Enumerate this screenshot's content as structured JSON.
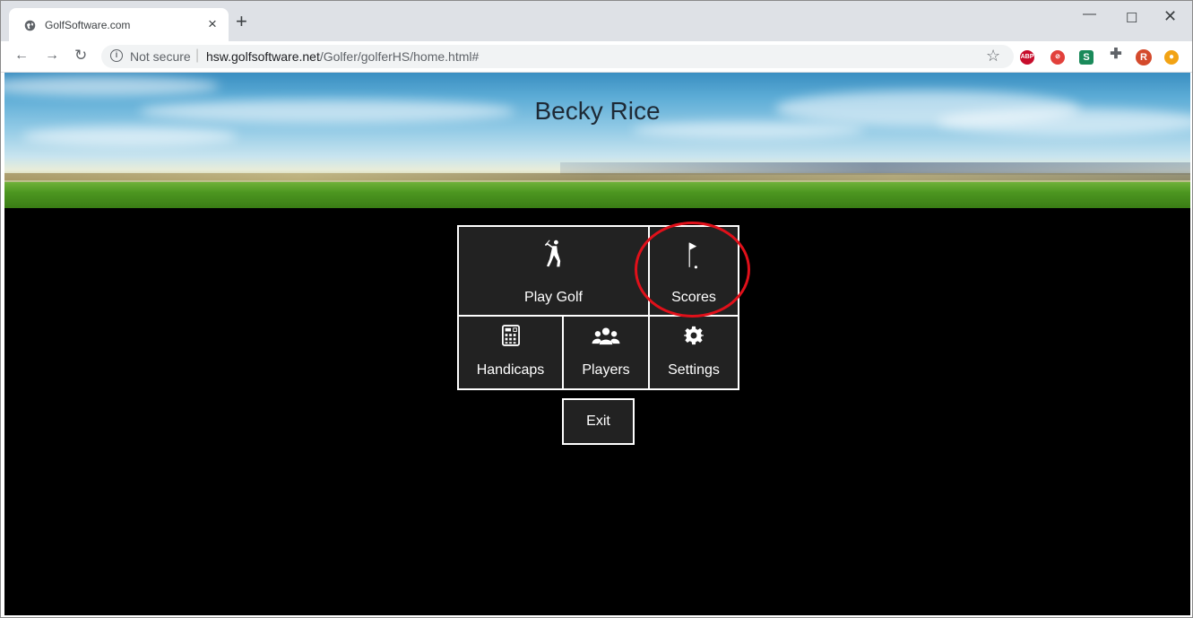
{
  "browser": {
    "tab_title": "GolfSoftware.com",
    "security_label": "Not secure",
    "url_host": "hsw.golfsoftware.net",
    "url_path": "/Golfer/golferHS/home.html#",
    "extensions": [
      "abp-icon",
      "red-extension-icon",
      "s-extension-icon",
      "puzzle-icon",
      "profile-avatar",
      "orange-extension-icon"
    ],
    "ext_abp_text": "ABP",
    "ext_s_text": "S",
    "avatar_initial": "R"
  },
  "page": {
    "player_name": "Becky Rice",
    "menu": {
      "play_golf": "Play Golf",
      "scores": "Scores",
      "handicaps": "Handicaps",
      "players": "Players",
      "settings": "Settings",
      "exit": "Exit"
    },
    "highlight_color": "#e0101a"
  }
}
